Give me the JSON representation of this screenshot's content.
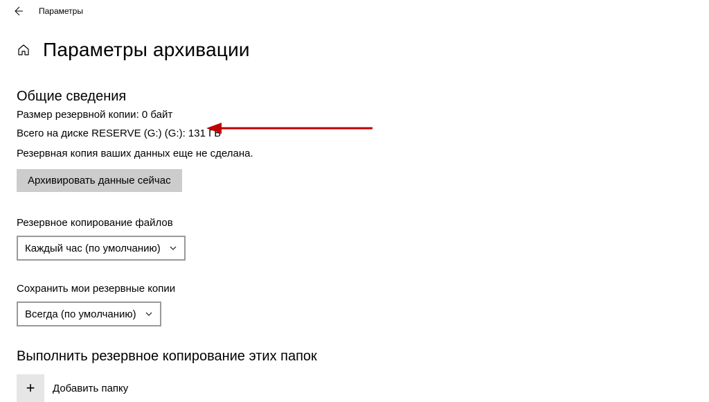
{
  "titlebar": {
    "label": "Параметры"
  },
  "header": {
    "title": "Параметры архивации"
  },
  "overview": {
    "heading": "Общие сведения",
    "backup_size": "Размер резервной копии: 0 байт",
    "disk_total": "Всего на диске RESERVE (G:) (G:): 131 ГБ",
    "not_backed_up": "Резервная копия ваших данных еще не сделана.",
    "backup_now_button": "Архивировать данные сейчас"
  },
  "frequency": {
    "label": "Резервное копирование файлов",
    "selected": "Каждый час (по умолчанию)"
  },
  "retention": {
    "label": "Сохранить мои резервные копии",
    "selected": "Всегда (по умолчанию)"
  },
  "folders": {
    "heading": "Выполнить резервное копирование этих папок",
    "add_label": "Добавить папку"
  }
}
